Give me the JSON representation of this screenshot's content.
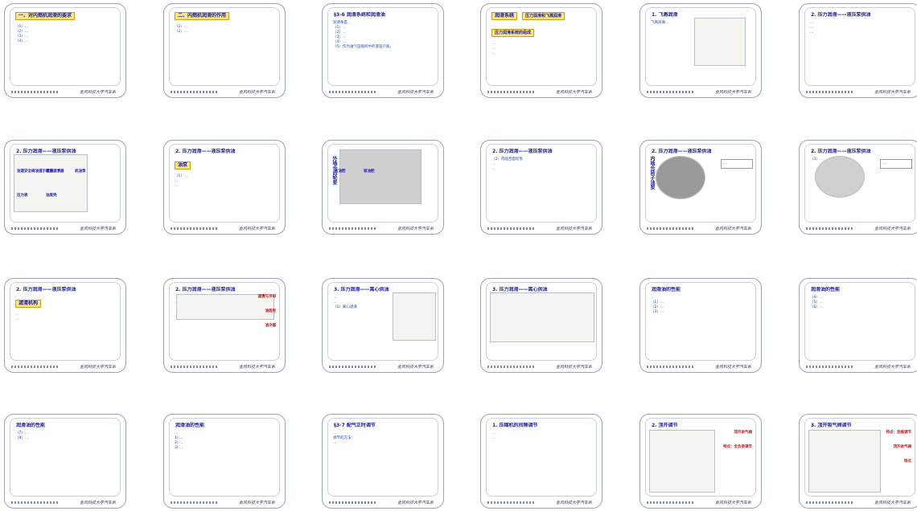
{
  "footer_signature": "金风科技大学汽车系",
  "slides": [
    {
      "title": "一、对内燃机润滑的要求",
      "lines": [
        "（1）…",
        "（2）…",
        "（3）…",
        "（4）…"
      ]
    },
    {
      "title": "二、内燃机润滑的作用",
      "lines": [
        "（1）…",
        "（2）…"
      ]
    },
    {
      "title": "§3-6 润滑系统和润滑油",
      "lines": [
        "润滑系是…",
        "（1）…",
        "（2）…",
        "（3）…",
        "（4）…",
        "（5）作为油气压缩机中的液压介质。"
      ]
    },
    {
      "title": "润滑系统",
      "boxes": [
        "压力润滑和飞溅润滑",
        "压力润滑系统的组成"
      ],
      "lines": [
        "…",
        "…",
        "…"
      ]
    },
    {
      "title": "1. 飞溅润滑",
      "lines": [
        "飞溅润滑…"
      ]
    },
    {
      "title": "2. 压力润滑——液压泵供油",
      "lines": [
        "…",
        "…",
        "…"
      ]
    },
    {
      "title": "2. 压力润滑——液压泵供油",
      "labels": [
        "油道安全阀油道示意图",
        "机油滤清器",
        "机油泵",
        "压力表",
        "油底壳"
      ]
    },
    {
      "title": "2. 压力润滑——液压泵供油",
      "box": "油泵",
      "lines": [
        "（1）…",
        "…",
        "…"
      ]
    },
    {
      "title": "",
      "vlabel": "外啮合齿轮泵",
      "labels": [
        "压油腔",
        "吸油腔"
      ],
      "lines": [
        "…",
        "…"
      ]
    },
    {
      "title": "2. 压力润滑——液压泵供油",
      "lines": [
        "（2）内啮合齿轮泵",
        "…",
        "…"
      ]
    },
    {
      "title": "2. 压力润滑——液压泵供油",
      "vlabel": "内啮合转子油泵",
      "side": "…"
    },
    {
      "title": "2. 压力润滑——液压泵供油",
      "lines": [
        "（3）…"
      ],
      "side": "…"
    },
    {
      "title": "2. 压力润滑——液压泵供油",
      "box": "滤清机构",
      "lines": [
        "…",
        "…"
      ]
    },
    {
      "title": "2. 压力润滑——液压泵供油",
      "tags": [
        "滤清与冷却",
        "油底壳",
        "油冷器"
      ],
      "lines": [
        "…",
        "…"
      ]
    },
    {
      "title": "3. 压力润滑——离心供油",
      "lines": [
        "…",
        "…",
        "（1）离心滤清"
      ]
    },
    {
      "title": "3. 压力润滑——离心供油",
      "lines": [
        "…"
      ]
    },
    {
      "title": "润滑油的性能",
      "lines": [
        "…",
        "（1）…",
        "（2）…",
        "（3）…"
      ]
    },
    {
      "title": "润滑油的性能",
      "lines": [
        "（4）…",
        "（5）…",
        "（6）…"
      ]
    },
    {
      "title": "润滑油的性能",
      "lines": [
        "（7）…",
        "（8）…"
      ]
    },
    {
      "title": "润滑油的性能",
      "lines": [
        "…",
        "1) …",
        "2) …",
        "3) …"
      ]
    },
    {
      "title": "§3-7 配气正时调节",
      "lines": [
        "…",
        "调节的方法：",
        "…"
      ]
    },
    {
      "title": "1. 压缩机的间隙调节",
      "lines": [
        "…",
        "…"
      ]
    },
    {
      "title": "2. 顶开调节",
      "tags": [
        "顶开进气阀",
        "特点：全负荷调节"
      ]
    },
    {
      "title": "3. 顶开吸气阀调节",
      "tags": [
        "特点：连续调节",
        "顶开进气阀",
        "特点"
      ]
    }
  ]
}
